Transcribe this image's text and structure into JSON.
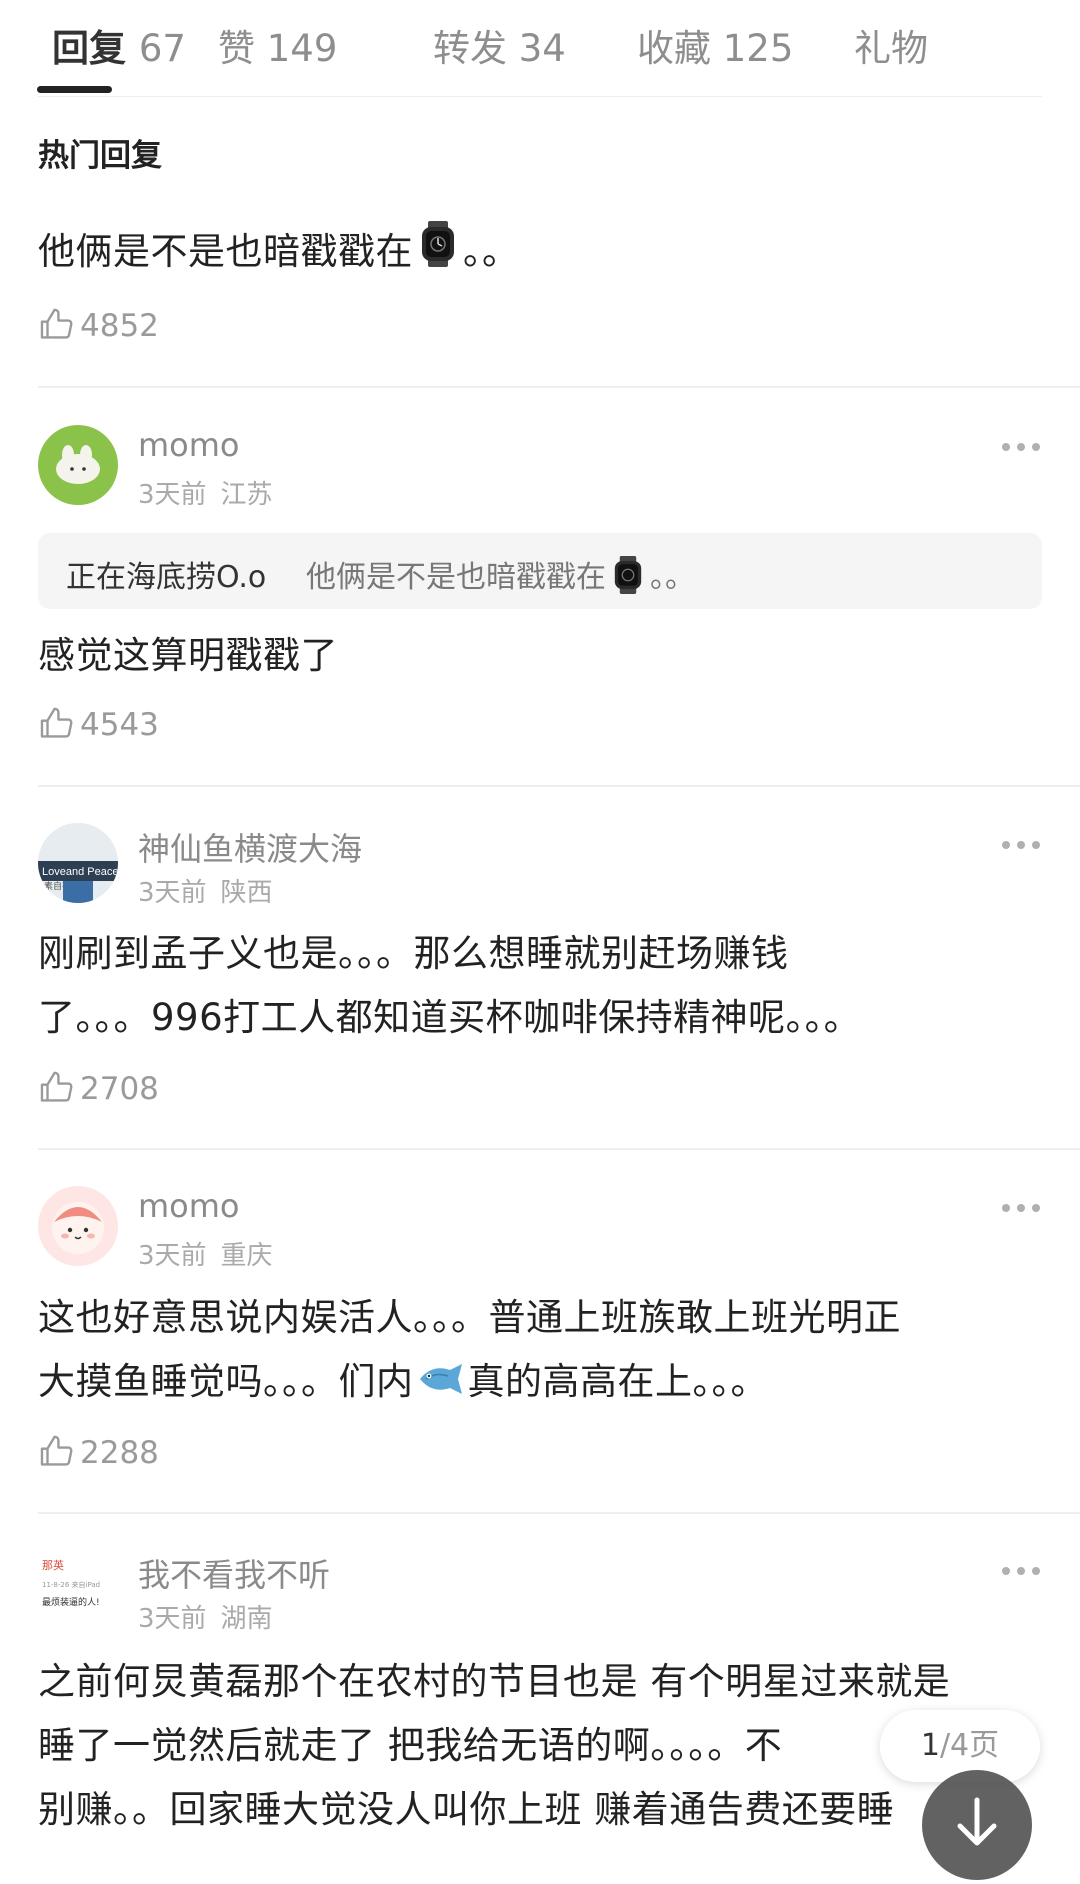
{
  "tabs": [
    {
      "label": "回复",
      "count": "67"
    },
    {
      "label": "赞",
      "count": "149"
    },
    {
      "label": "转发",
      "count": "34"
    },
    {
      "label": "收藏",
      "count": "125"
    },
    {
      "label": "礼物",
      "count": ""
    }
  ],
  "section_title": "热门回复",
  "top_comment": {
    "text": "他俩是不是也暗戳戳在",
    "suffix": "。。",
    "emoji": "watch-emoji",
    "likes": "4852"
  },
  "comments": [
    {
      "username": "momo",
      "time": "3天前",
      "location": "江苏",
      "avatar": "green-bunny-avatar",
      "quote_user": "正在海底捞O.o",
      "quote_text": "他俩是不是也暗戳戳在",
      "quote_suffix": "。。",
      "text": "感觉这算明戳戳了",
      "likes": "4543"
    },
    {
      "username": "神仙鱼横渡大海",
      "time": "3天前",
      "location": "陕西",
      "avatar": "photo-sign-avatar",
      "avatar_text_1": "Loveand Peace",
      "avatar_text_2": "素自在",
      "line1": "刚刷到孟子义也是。。。那么想睡就别赶场赚钱",
      "line2": "了。。。996打工人都知道买杯咖啡保持精神呢。。。",
      "likes": "2708"
    },
    {
      "username": "momo",
      "time": "3天前",
      "location": "重庆",
      "avatar": "pink-character-avatar",
      "line1": "这也好意思说内娱活人。。。普通上班族敢上班光明正",
      "line2_a": "大摸鱼睡觉吗。。。们内",
      "line2_b": "真的高高在上。。。",
      "emoji": "fish-emoji",
      "likes": "2288"
    },
    {
      "username": "我不看我不听",
      "time": "3天前",
      "location": "湖南",
      "avatar": "text-avatar",
      "avatar_text_1": "那英",
      "avatar_text_2": "11-8-26 来自iPad",
      "avatar_text_3": "最烦装逼的人!",
      "line1": "之前何炅黄磊那个在农村的节目也是 有个明星过来就是",
      "line2": "睡了一觉然后就走了 把我给无语的啊。。。。不",
      "line3": "别赚。。回家睡大觉没人叫你上班 赚着通告费还要睡"
    }
  ],
  "pager": {
    "current": "1",
    "total": "/4页"
  },
  "fab_icon": "arrow-down-icon",
  "like_icon": "thumb-up-icon",
  "more_icon": "more-dots-icon"
}
